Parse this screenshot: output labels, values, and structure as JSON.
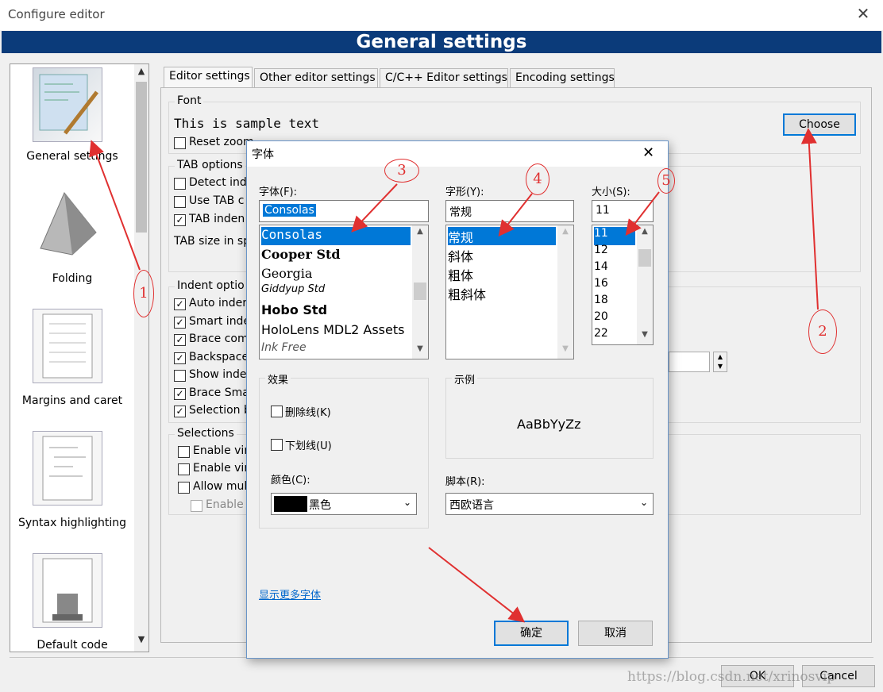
{
  "window": {
    "title": "Configure editor",
    "close": "✕"
  },
  "banner": "General settings",
  "sidebar": {
    "items": [
      {
        "label": "General settings",
        "icon": "general-settings-icon"
      },
      {
        "label": "Folding",
        "icon": "folding-icon"
      },
      {
        "label": "Margins and caret",
        "icon": "margins-icon"
      },
      {
        "label": "Syntax highlighting",
        "icon": "syntax-icon"
      },
      {
        "label": "Default code",
        "icon": "default-code-icon"
      }
    ]
  },
  "tabs": [
    "Editor settings",
    "Other editor settings",
    "C/C++ Editor settings",
    "Encoding settings"
  ],
  "font_group": {
    "label": "Font",
    "sample": "This is sample text",
    "reset": "Reset zoom",
    "choose": "Choose"
  },
  "tab_group": {
    "label": "TAB options",
    "items": [
      {
        "label": "Detect ind",
        "checked": false
      },
      {
        "label": "Use TAB c",
        "checked": false
      },
      {
        "label": "TAB inden",
        "checked": true
      }
    ],
    "size_label": "TAB size in sp"
  },
  "indent_group": {
    "label": "Indent optio",
    "items": [
      {
        "label": "Auto inder",
        "checked": true
      },
      {
        "label": "Smart inde",
        "checked": true
      },
      {
        "label": "Brace com",
        "checked": true
      },
      {
        "label": "Backspace",
        "checked": true
      },
      {
        "label": "Show inde",
        "checked": false
      },
      {
        "label": "Brace Sma",
        "checked": true
      },
      {
        "label": "Selection b",
        "checked": true
      }
    ]
  },
  "sel_group": {
    "label": "Selections",
    "items": [
      {
        "label": "Enable vir",
        "checked": false
      },
      {
        "label": "Enable vir",
        "checked": false
      },
      {
        "label": "Allow mul",
        "checked": false
      },
      {
        "label": "Enable",
        "checked": false
      }
    ]
  },
  "footer": {
    "ok": "OK",
    "cancel": "Cancel",
    "watermark": "https://blog.csdn.net/xrinosvip"
  },
  "font_dialog": {
    "title": "字体",
    "close": "✕",
    "font_label": "字体(F):",
    "font_value": "Consolas",
    "fonts": [
      "Consolas",
      "Cooper Std",
      "Georgia",
      "Giddyup Std",
      "Hobo Std",
      "HoloLens MDL2 Assets",
      "Ink Free"
    ],
    "style_label": "字形(Y):",
    "style_value": "常规",
    "styles": [
      "常规",
      "斜体",
      "粗体",
      "粗斜体"
    ],
    "size_label": "大小(S):",
    "size_value": "11",
    "sizes": [
      "11",
      "12",
      "14",
      "16",
      "18",
      "20",
      "22"
    ],
    "effects_label": "效果",
    "strike": "删除线(K)",
    "underline": "下划线(U)",
    "color_label": "颜色(C):",
    "color_value": "黑色",
    "sample_label": "示例",
    "sample_text": "AaBbYyZz",
    "script_label": "脚本(R):",
    "script_value": "西欧语言",
    "more_fonts": "显示更多字体",
    "ok": "确定",
    "cancel": "取消"
  },
  "annotations": [
    "1",
    "2",
    "3",
    "4",
    "5"
  ],
  "colors": {
    "accent": "#0078d7",
    "banner": "#0b3b7a",
    "annotation": "#e03030"
  }
}
